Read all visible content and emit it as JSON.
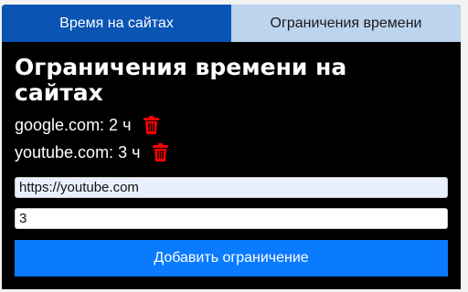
{
  "tabs": [
    {
      "label": "Время на сайтах",
      "active": true
    },
    {
      "label": "Ограничения времени",
      "active": false
    }
  ],
  "page_title": "Ограничения времени на сайтах",
  "limits": [
    {
      "label": "google.com: 2 ч",
      "icon": "trash-icon"
    },
    {
      "label": "youtube.com: 3 ч",
      "icon": "trash-icon"
    }
  ],
  "form": {
    "url_value": "https://youtube.com",
    "hours_value": "3",
    "add_button_label": "Добавить ограничение"
  },
  "colors": {
    "active_tab": "#0a54b4",
    "inactive_tab": "#bcd4ee",
    "background": "#000000",
    "delete_icon": "#ff0000",
    "button": "#0a7bff"
  }
}
